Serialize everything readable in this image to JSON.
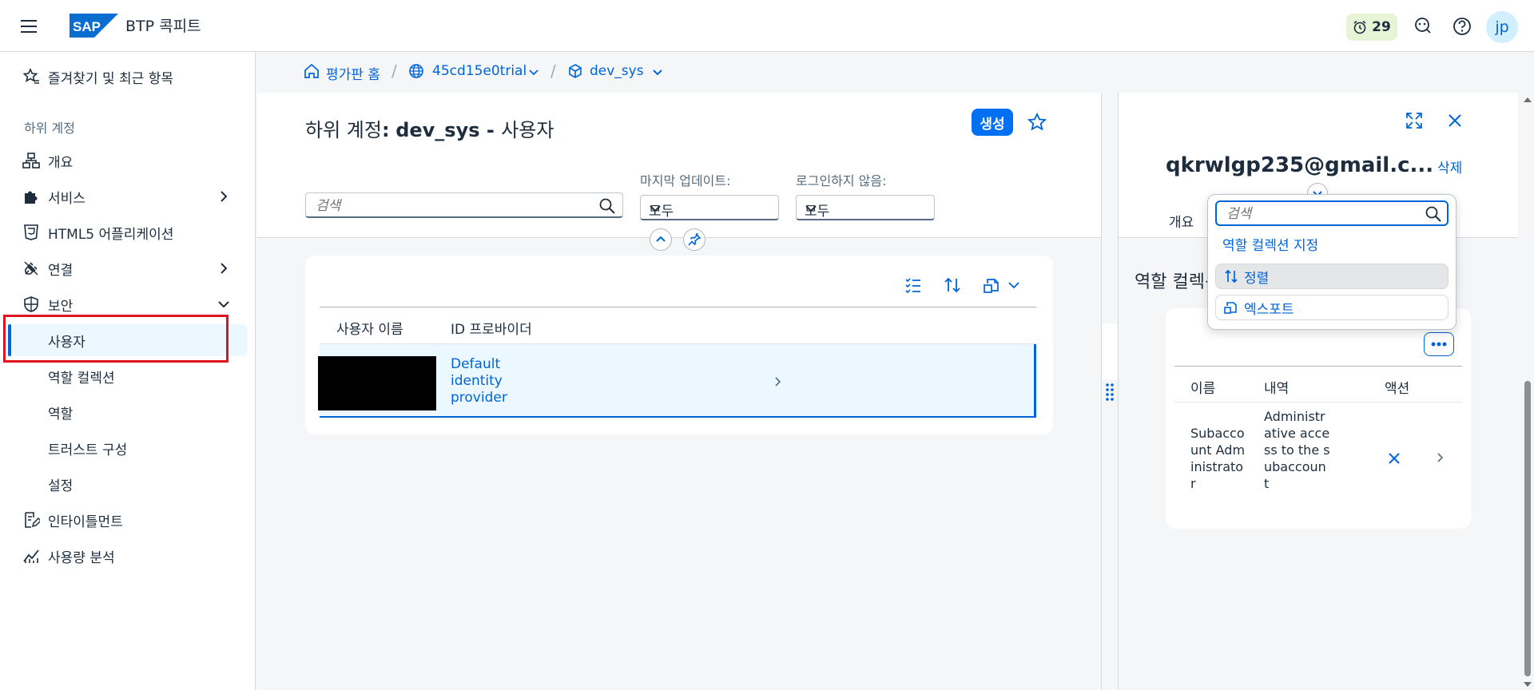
{
  "shell": {
    "title": "BTP 콕피트",
    "logo_text": "SAP",
    "trial_days": "29",
    "avatar_initials": "jp"
  },
  "sidenav": {
    "favorites": "즐겨찾기 및 최근 항목",
    "group_label": "하위 계정",
    "items": [
      {
        "label": "개요"
      },
      {
        "label": "서비스"
      },
      {
        "label": "HTML5 어플리케이션"
      },
      {
        "label": "연결"
      },
      {
        "label": "보안"
      }
    ],
    "security_children": [
      {
        "label": "사용자"
      },
      {
        "label": "역할 컬렉션"
      },
      {
        "label": "역할"
      },
      {
        "label": "트러스트 구성"
      },
      {
        "label": "설정"
      }
    ],
    "bottom_items": [
      {
        "label": "인타이틀먼트"
      },
      {
        "label": "사용량 분석"
      }
    ]
  },
  "breadcrumb": {
    "home": "평가판 홈",
    "account": "45cd15e0trial",
    "subaccount": "dev_sys",
    "separator": "/"
  },
  "main": {
    "title_prefix": "하위 계정",
    "title_colon": ":",
    "title_name": "dev_sys",
    "title_dash": " - ",
    "title_suffix": "사용자",
    "create_button": "생성",
    "search_placeholder": "검색",
    "filter_last_update_label": "마지막 업데이트:",
    "filter_last_update_value": "모두",
    "filter_not_logged_label": "로그인하지 않음:",
    "filter_not_logged_value": "모두",
    "table": {
      "col_username": "사용자 이름",
      "col_idp": "ID 프로바이더",
      "rows": [
        {
          "idp": "Default identity provider"
        }
      ]
    }
  },
  "detail": {
    "email": "qkrwlgp235@gmail.c...",
    "delete": "삭제",
    "tab_overview": "개요",
    "section_title": "역할 컬렉션",
    "table": {
      "col_name": "이름",
      "col_desc": "내역",
      "col_action": "액션",
      "rows": [
        {
          "name": "Subaccount Administrator",
          "desc": "Administrative access to the subaccount"
        }
      ]
    }
  },
  "popover": {
    "search_placeholder": "검색",
    "items": [
      {
        "label": "역할 컬렉션 지정"
      },
      {
        "label": "정렬"
      },
      {
        "label": "엑스포트"
      }
    ]
  },
  "colors": {
    "brand": "#0070f2",
    "link": "#0064d9",
    "selection_bg": "#ebf8ff",
    "highlight_box": "#e0141f"
  }
}
